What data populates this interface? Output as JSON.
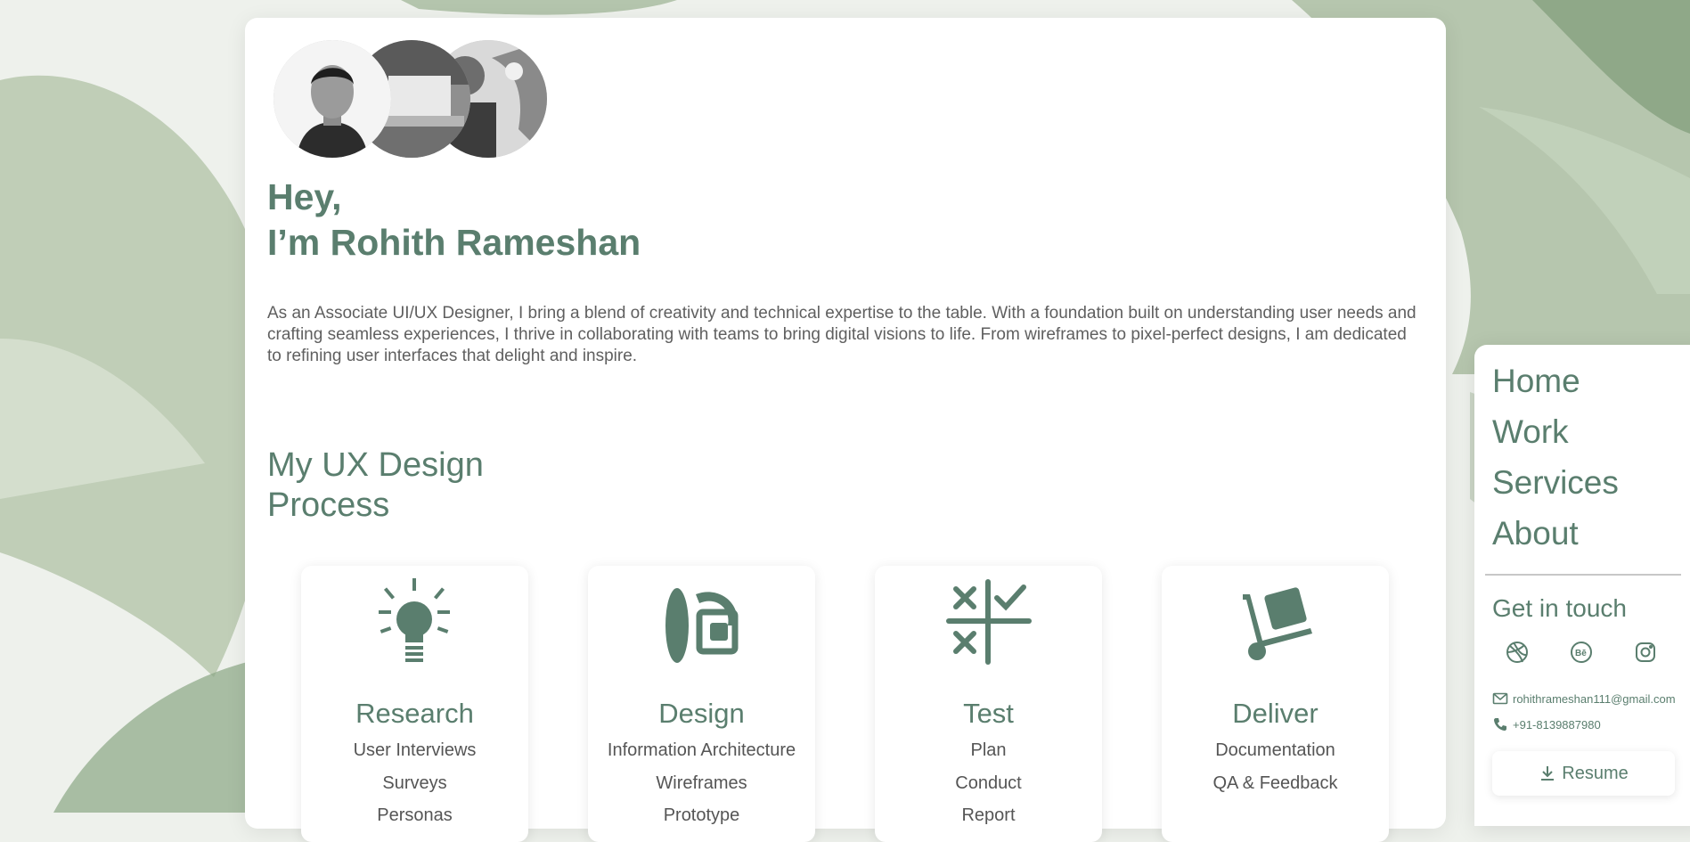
{
  "hero": {
    "greeting_line1": "Hey,",
    "greeting_line2": "I’m Rohith Rameshan",
    "intro": "As an Associate UI/UX Designer, I bring a blend of creativity and technical expertise to the table. With a foundation built on understanding user needs and crafting seamless experiences, I thrive in collaborating with teams to bring digital visions to life. From wireframes to pixel-perfect designs, I am dedicated to refining user interfaces that delight and inspire."
  },
  "process": {
    "title_line1": "My UX Design",
    "title_line2": "Process",
    "steps": [
      {
        "title": "Research",
        "icon": "lightbulb-icon",
        "items": [
          "User Interviews",
          "Surveys",
          "Personas"
        ]
      },
      {
        "title": "Design",
        "icon": "design-tools-icon",
        "items": [
          "Information Architecture",
          "Wireframes",
          "Prototype"
        ]
      },
      {
        "title": "Test",
        "icon": "test-grid-icon",
        "items": [
          "Plan",
          "Conduct",
          "Report"
        ]
      },
      {
        "title": "Deliver",
        "icon": "hand-truck-icon",
        "items": [
          "Documentation",
          "QA & Feedback"
        ]
      }
    ]
  },
  "sidebar": {
    "nav": [
      "Home",
      "Work",
      "Services",
      "About"
    ],
    "get_in_touch": "Get in touch",
    "social": [
      "dribbble-icon",
      "behance-icon",
      "instagram-icon"
    ],
    "email": "rohithrameshan111@gmail.com",
    "phone": "+91-8139887980",
    "resume_label": "Resume"
  },
  "colors": {
    "accent": "#5a7e6e",
    "body_text": "#5f5f5f",
    "background": "#eef1ec"
  }
}
